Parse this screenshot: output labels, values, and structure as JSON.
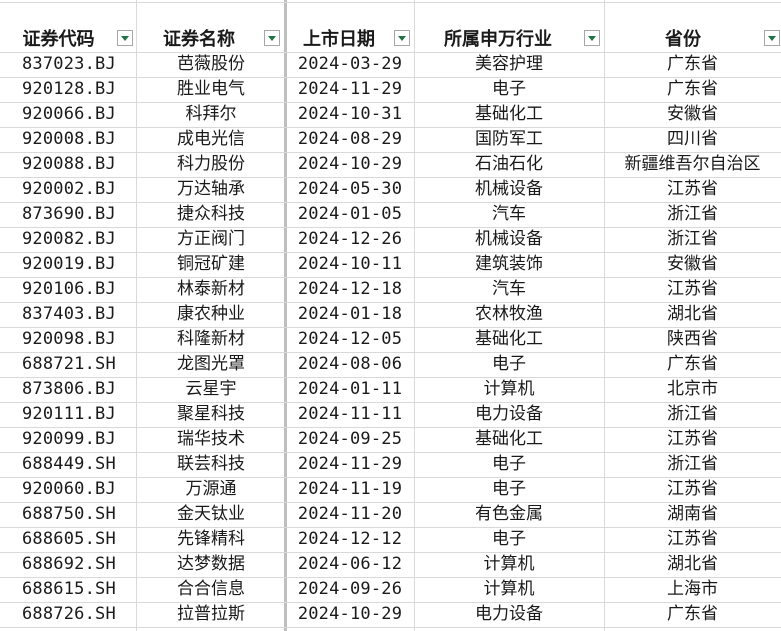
{
  "headers": [
    {
      "label": "证券代码"
    },
    {
      "label": "证券名称"
    },
    {
      "label": "上市日期"
    },
    {
      "label": "所属申万行业"
    },
    {
      "label": "省份"
    }
  ],
  "rows": [
    {
      "code": "837023.BJ",
      "name": "芭薇股份",
      "date": "2024-03-29",
      "industry": "美容护理",
      "province": "广东省"
    },
    {
      "code": "920128.BJ",
      "name": "胜业电气",
      "date": "2024-11-29",
      "industry": "电子",
      "province": "广东省"
    },
    {
      "code": "920066.BJ",
      "name": "科拜尔",
      "date": "2024-10-31",
      "industry": "基础化工",
      "province": "安徽省"
    },
    {
      "code": "920008.BJ",
      "name": "成电光信",
      "date": "2024-08-29",
      "industry": "国防军工",
      "province": "四川省"
    },
    {
      "code": "920088.BJ",
      "name": "科力股份",
      "date": "2024-10-29",
      "industry": "石油石化",
      "province": "新疆维吾尔自治区"
    },
    {
      "code": "920002.BJ",
      "name": "万达轴承",
      "date": "2024-05-30",
      "industry": "机械设备",
      "province": "江苏省"
    },
    {
      "code": "873690.BJ",
      "name": "捷众科技",
      "date": "2024-01-05",
      "industry": "汽车",
      "province": "浙江省"
    },
    {
      "code": "920082.BJ",
      "name": "方正阀门",
      "date": "2024-12-26",
      "industry": "机械设备",
      "province": "浙江省"
    },
    {
      "code": "920019.BJ",
      "name": "铜冠矿建",
      "date": "2024-10-11",
      "industry": "建筑装饰",
      "province": "安徽省"
    },
    {
      "code": "920106.BJ",
      "name": "林泰新材",
      "date": "2024-12-18",
      "industry": "汽车",
      "province": "江苏省"
    },
    {
      "code": "837403.BJ",
      "name": "康农种业",
      "date": "2024-01-18",
      "industry": "农林牧渔",
      "province": "湖北省"
    },
    {
      "code": "920098.BJ",
      "name": "科隆新材",
      "date": "2024-12-05",
      "industry": "基础化工",
      "province": "陕西省"
    },
    {
      "code": "688721.SH",
      "name": "龙图光罩",
      "date": "2024-08-06",
      "industry": "电子",
      "province": "广东省"
    },
    {
      "code": "873806.BJ",
      "name": "云星宇",
      "date": "2024-01-11",
      "industry": "计算机",
      "province": "北京市"
    },
    {
      "code": "920111.BJ",
      "name": "聚星科技",
      "date": "2024-11-11",
      "industry": "电力设备",
      "province": "浙江省"
    },
    {
      "code": "920099.BJ",
      "name": "瑞华技术",
      "date": "2024-09-25",
      "industry": "基础化工",
      "province": "江苏省"
    },
    {
      "code": "688449.SH",
      "name": "联芸科技",
      "date": "2024-11-29",
      "industry": "电子",
      "province": "浙江省"
    },
    {
      "code": "920060.BJ",
      "name": "万源通",
      "date": "2024-11-19",
      "industry": "电子",
      "province": "江苏省"
    },
    {
      "code": "688750.SH",
      "name": "金天钛业",
      "date": "2024-11-20",
      "industry": "有色金属",
      "province": "湖南省"
    },
    {
      "code": "688605.SH",
      "name": "先锋精科",
      "date": "2024-12-12",
      "industry": "电子",
      "province": "江苏省"
    },
    {
      "code": "688692.SH",
      "name": "达梦数据",
      "date": "2024-06-12",
      "industry": "计算机",
      "province": "湖北省"
    },
    {
      "code": "688615.SH",
      "name": "合合信息",
      "date": "2024-09-26",
      "industry": "计算机",
      "province": "上海市"
    },
    {
      "code": "688726.SH",
      "name": "拉普拉斯",
      "date": "2024-10-29",
      "industry": "电力设备",
      "province": "广东省"
    }
  ],
  "colors": {
    "grid": "#d9d9d9",
    "filter_arrow": "#217346"
  }
}
